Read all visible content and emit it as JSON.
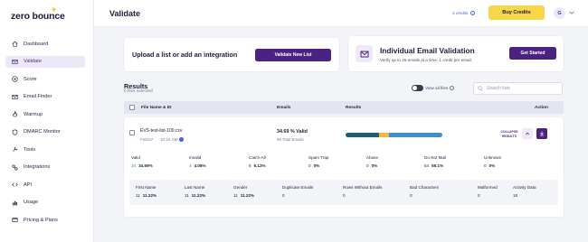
{
  "brand": {
    "name": "zero bounce"
  },
  "sidebar": {
    "items": [
      {
        "label": "Dashboard",
        "icon": "home-icon"
      },
      {
        "label": "Validate",
        "icon": "envelope-icon",
        "active": true
      },
      {
        "label": "Score",
        "icon": "score-icon"
      },
      {
        "label": "Email Finder",
        "icon": "email-finder-icon"
      },
      {
        "label": "Warmup",
        "icon": "fire-icon"
      },
      {
        "label": "DMARC Monitor",
        "icon": "shield-icon"
      },
      {
        "label": "Tools",
        "icon": "tools-icon"
      },
      {
        "label": "Integrations",
        "icon": "integrations-icon"
      },
      {
        "label": "API",
        "icon": "api-icon"
      },
      {
        "label": "Usage",
        "icon": "usage-icon"
      },
      {
        "label": "Pricing & Plans",
        "icon": "pricing-icon"
      }
    ]
  },
  "header": {
    "title": "Validate",
    "credits": "2 credits",
    "buy_label": "Buy Credits",
    "avatar_initial": "G"
  },
  "upload": {
    "title": "Upload a list or add an integration",
    "button": "Validate New List"
  },
  "single": {
    "title": "Individual Email Validation",
    "subtitle": "Verify up to 25 emails at a time. 1 credit per email.",
    "button": "Get Started"
  },
  "results": {
    "title": "Results",
    "selected": "0 files selected",
    "view_all": "View all files",
    "search_placeholder": "Search lists",
    "columns": {
      "file": "File Name & ID",
      "emails": "Emails",
      "results": "Results",
      "action": "Action"
    }
  },
  "file": {
    "name": "EVS-test-list-100.csv",
    "date": "Feb/27",
    "time": "10:24 AM",
    "valid_summary": "34.69 % Valid",
    "total_emails": "98 Total Emails",
    "collapse_label": "COLLAPSE RESULTS",
    "bar": [
      {
        "name": "Valid",
        "fraction": 0.3469,
        "color": "#1f5f73"
      },
      {
        "name": "Catch-All",
        "fraction": 0.0612,
        "color": "#f3b53f"
      },
      {
        "name": "Invalid",
        "fraction": 0.0408,
        "color": "#f3b53f"
      },
      {
        "name": "Do Not Mail",
        "fraction": 0.5511,
        "color": "#3d8fd0"
      }
    ],
    "stats": [
      {
        "label": "Valid",
        "count": "34",
        "pct": "34.69%",
        "color": "#2e9a5e"
      },
      {
        "label": "Invalid",
        "count": "4",
        "pct": "4.08%",
        "color": "#d83a3a"
      },
      {
        "label": "Catch-All",
        "count": "6",
        "pct": "6.12%",
        "color": "#1e1b3a"
      },
      {
        "label": "Spam Trap",
        "count": "0",
        "pct": "0%",
        "color": "#1e1b3a"
      },
      {
        "label": "Abuse",
        "count": "0",
        "pct": "0%",
        "color": "#1e1b3a"
      },
      {
        "label": "Do Not Mail",
        "count": "54",
        "pct": "55.1%",
        "color": "#1e1b3a"
      },
      {
        "label": "Unknown",
        "count": "0",
        "pct": "0%",
        "color": "#1e1b3a"
      }
    ],
    "details": [
      {
        "label": "First Name",
        "count": "11",
        "pct": "11.22%"
      },
      {
        "label": "Last Name",
        "count": "11",
        "pct": "11.22%"
      },
      {
        "label": "Gender",
        "count": "11",
        "pct": "11.22%"
      },
      {
        "label": "Duplicate Emails",
        "count": "0",
        "pct": ""
      },
      {
        "label": "Rows Without Emails",
        "count": "0",
        "pct": ""
      },
      {
        "label": "Bad Characters",
        "count": "0",
        "pct": ""
      },
      {
        "label": "Malformed",
        "count": "0",
        "pct": ""
      },
      {
        "label": "Activity Data",
        "count": "18",
        "pct": ""
      }
    ]
  }
}
